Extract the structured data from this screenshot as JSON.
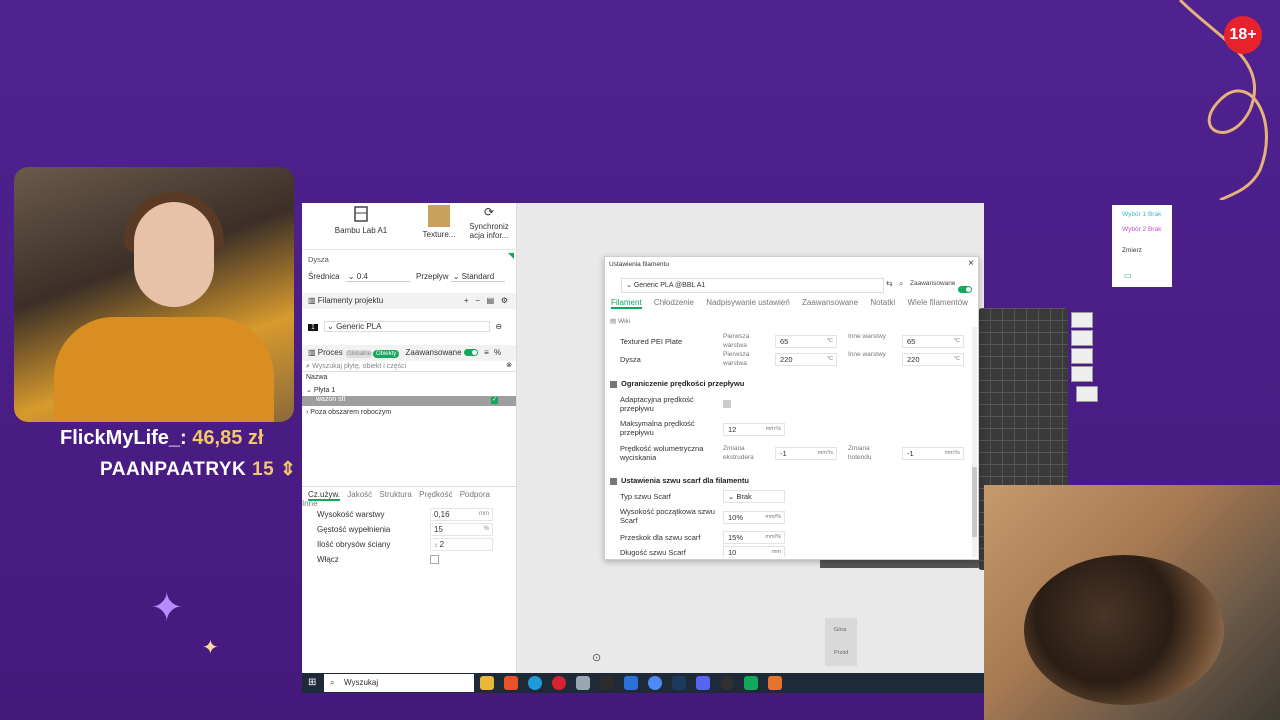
{
  "overlay": {
    "badge": "18+",
    "donor_name": "FlickMyLife_:",
    "donor_amount": "46,85 zł",
    "sub_name": "PAANPAATRYK",
    "sub_count": "15",
    "colors": {
      "accent": "#f1c86a",
      "bg": "#4a1f86",
      "badge": "#e8222c"
    }
  },
  "printer": {
    "printer_name": "Bambu Lab A1",
    "plate_name": "Texture...",
    "sync_label": "Synchroniz acja infor...",
    "nozzle_section": "Dysza",
    "diameter_label": "Średnica",
    "diameter_value": "0.4",
    "flow_label": "Przepływ",
    "flow_value": "Standard"
  },
  "filaments": {
    "header": "Filamenty projektu",
    "item_index": "1",
    "item": "Generic PLA"
  },
  "process": {
    "header": "Proces",
    "global": "Globalne",
    "objects": "Obiekty",
    "advanced": "Zaawansowane",
    "search_placeholder": "Wyszukaj płytę, obiekt i części",
    "name_col": "Nazwa",
    "plate": "Płyta 1",
    "object": "wazon stl",
    "outside": "Poza obszarem roboczym"
  },
  "proc_tabs": [
    "Cz.używ.",
    "Jakość",
    "Struktura",
    "Prędkość",
    "Podpora",
    "Inne"
  ],
  "props": [
    {
      "name": "Wysokość warstwy",
      "value": "0,16",
      "unit": "mm"
    },
    {
      "name": "Gęstość wypełnienia",
      "value": "15",
      "unit": "%"
    },
    {
      "name": "Ilość obrysów ściany",
      "value": "2",
      "unit": ""
    },
    {
      "name": "Włącz",
      "value": "",
      "unit": ""
    }
  ],
  "right_panel": {
    "sel1": "Wybór 1 Brak",
    "sel2": "Wybór 2 Brak",
    "measure": "Zmierz"
  },
  "view_cube": {
    "top": "Góra",
    "front": "Przód"
  },
  "dialog": {
    "title": "Ustawienia filamentu",
    "preset": "Generic PLA @BBL A1",
    "advanced": "Zaawansowane",
    "tabs": [
      "Filament",
      "Chłodzenie",
      "Nadpisywanie ustawień",
      "Zaawansowane",
      "Notatki",
      "Wiele filamentów"
    ],
    "wiki": "Wiki",
    "plate_label": "Textured PEI Plate",
    "nozzle_label": "Dysza",
    "first_layer": "Pierwsza warstwa",
    "other_layers": "Inne warstwy",
    "plate_first": "65",
    "plate_other": "65",
    "nozzle_first": "220",
    "nozzle_other": "220",
    "deg": "°C",
    "sec_flow": "Ograniczenie prędkości przepływu",
    "adaptive_label": "Adaptacyjna prędkość przepływu",
    "max_flow_label": "Maksymalna prędkość przepływu",
    "max_flow_value": "12",
    "max_flow_unit": "mm³/s",
    "vol_label": "Prędkość wolumetryczna wyciskania",
    "extruder_change": "Zmiana ekstrudera",
    "extruder_value": "-1",
    "hotend_change": "Zmiana hotendu",
    "hotend_value": "-1",
    "vol_unit": "mm³/s",
    "sec_scarf": "Ustawienia szwu scarf dla filamentu",
    "scarf_type_label": "Typ szwu Scarf",
    "scarf_type_value": "Brak",
    "scarf_start_label": "Wysokość początkowa szwu Scarf",
    "scarf_start_value": "10%",
    "scarf_start_unit": "mm/%",
    "scarf_gap_label": "Przeskok dla szwu scarf",
    "scarf_gap_value": "15%",
    "scarf_gap_unit": "mm/%",
    "scarf_len_label": "Długość szwu Scarf",
    "scarf_len_value": "10",
    "scarf_len_unit": "mm"
  },
  "taskbar": {
    "search": "Wyszukaj",
    "icons": [
      "folder-icon",
      "brave-icon",
      "edge-icon",
      "opera-icon",
      "app-icon",
      "epic-icon",
      "teams-icon",
      "chrome-icon",
      "steam-icon",
      "discord-icon",
      "obs-icon",
      "spreadsheet-icon",
      "orca-icon"
    ]
  }
}
